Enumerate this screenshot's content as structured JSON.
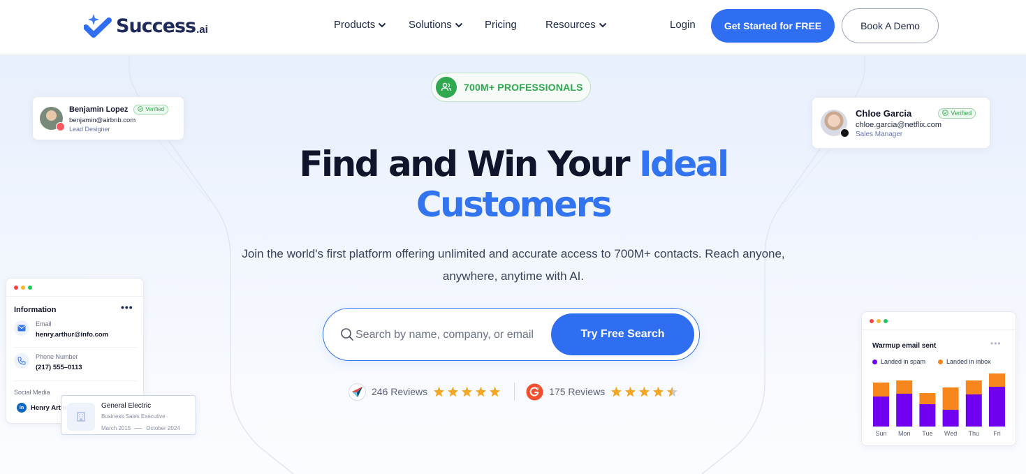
{
  "brand": {
    "name": "Success",
    "suffix": ".ai"
  },
  "nav": {
    "links": [
      {
        "label": "Products",
        "dropdown": true
      },
      {
        "label": "Solutions",
        "dropdown": true
      },
      {
        "label": "Pricing",
        "dropdown": false
      },
      {
        "label": "Resources",
        "dropdown": true
      }
    ],
    "login": "Login",
    "primary_cta": "Get Started for FREE",
    "secondary_cta": "Book A Demo"
  },
  "hero": {
    "badge": "700M+ PROFESSIONALS",
    "headline_dark": "Find and Win Your",
    "headline_blue_1": "Ideal",
    "headline_blue_2": "Customers",
    "subtext_line1": "Join the world's first platform offering unlimited and accurate access to 700M+ contacts. Reach anyone,",
    "subtext_line2": "anywhere, anytime with AI.",
    "search_placeholder": "Search by name, company, or email",
    "search_button": "Try Free Search"
  },
  "reviews": [
    {
      "source_icon": "capterra-icon",
      "count_label": "246 Reviews",
      "rating": 5
    },
    {
      "source_icon": "g2-icon",
      "count_label": "175 Reviews",
      "rating": 4.5
    }
  ],
  "profile_cards": {
    "left": {
      "name": "Benjamin Lopez",
      "email": "benjamin@airbnb.com",
      "role": "Lead Designer",
      "status": "Verified"
    },
    "right": {
      "name": "Chloe Garcia",
      "email": "chloe.garcia@netflix.com",
      "role": "Sales Manager",
      "status": "Verified"
    }
  },
  "info_card": {
    "title": "Information",
    "email_label": "Email",
    "email_value": "henry.arthur@info.com",
    "phone_label": "Phone Number",
    "phone_value": "(217) 555–0113",
    "social_label": "Social Media",
    "social_value": "Henry Arthur"
  },
  "experience_card": {
    "company": "General Electric",
    "title": "Business Sales Executive",
    "start": "March 2015",
    "end": "October 2024"
  },
  "colors": {
    "primary": "#2f6ef0",
    "headline_blue": "#3273f0",
    "spam": "#7000f0",
    "inbox": "#f7861d",
    "verified_green": "#2fa84f",
    "star": "#f5a623"
  },
  "chart_data": {
    "type": "bar",
    "title": "Warmup email sent",
    "categories": [
      "Sun",
      "Mon",
      "Tue",
      "Wed",
      "Thu",
      "Fri"
    ],
    "stacked": true,
    "series": [
      {
        "name": "Landed in spam",
        "values": [
          43,
          47,
          32,
          24,
          46,
          57
        ]
      },
      {
        "name": "Landed in inbox",
        "values": [
          20,
          19,
          16,
          32,
          20,
          19
        ]
      }
    ],
    "ylim": [
      0,
      76
    ],
    "grid": false,
    "legend": "top-left"
  }
}
